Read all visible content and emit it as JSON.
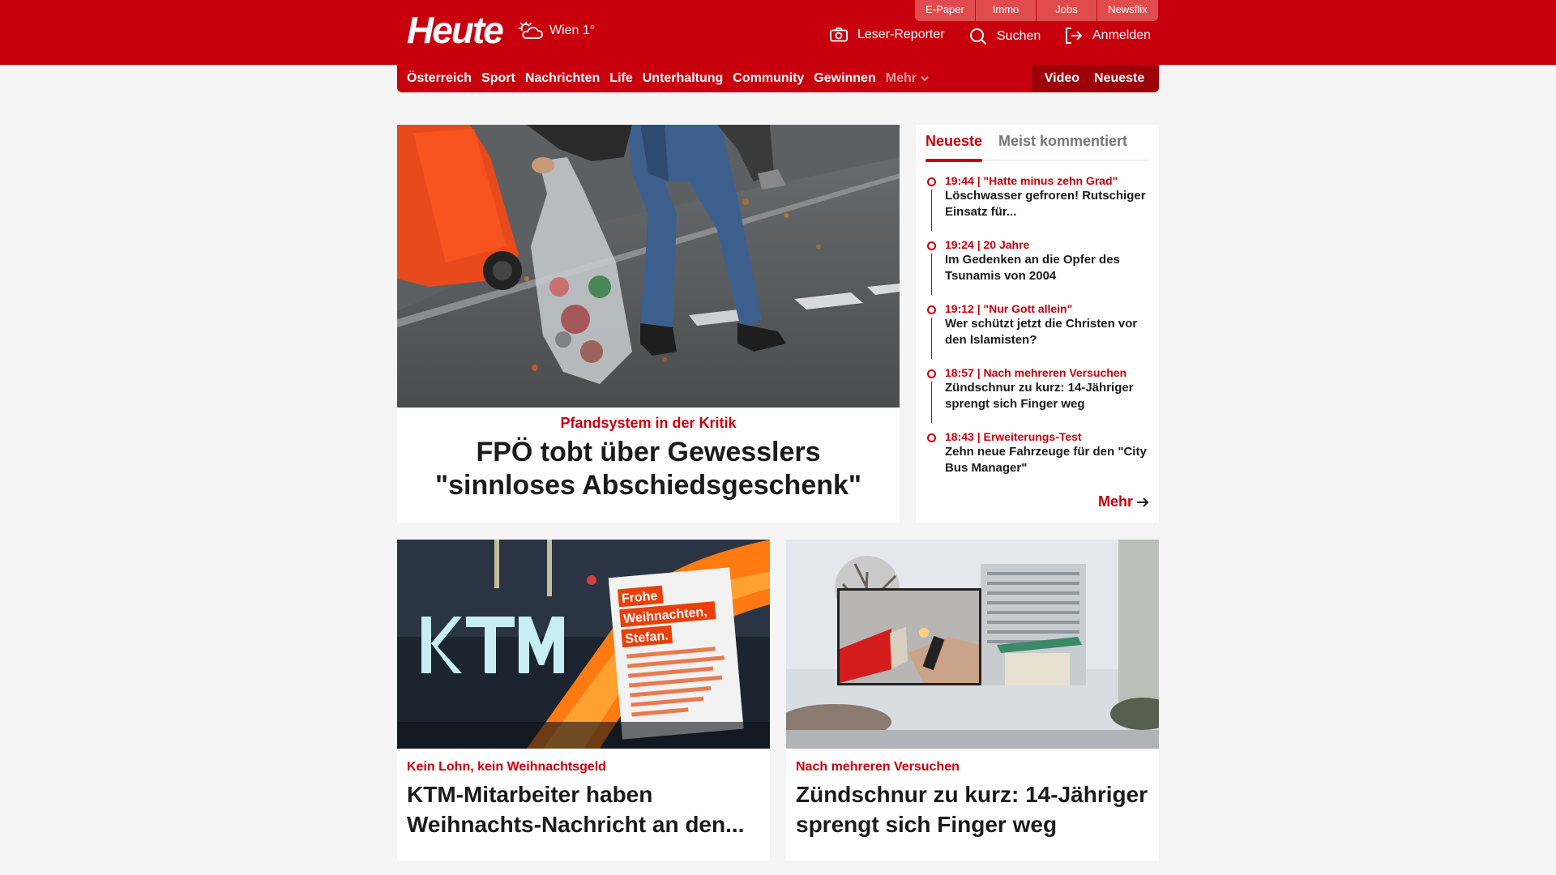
{
  "header": {
    "logo": "Heute",
    "weather": "Wien 1°",
    "top_links": [
      "E-Paper",
      "Immo",
      "Jobs",
      "Newsflix"
    ],
    "actions": {
      "reporter": "Leser-Reporter",
      "search": "Suchen",
      "login": "Anmelden"
    }
  },
  "nav": {
    "items": [
      "Österreich",
      "Sport",
      "Nachrichten",
      "Life",
      "Unterhaltung",
      "Community",
      "Gewinnen"
    ],
    "more": "Mehr",
    "video": "Video",
    "latest": "Neueste"
  },
  "lead": {
    "kicker": "Pfandsystem in der Kritik",
    "title": "FPÖ tobt über Gewesslers \"sinnloses Abschiedsgeschenk\""
  },
  "sidebar": {
    "tabs": [
      "Neueste",
      "Meist kommentiert"
    ],
    "items": [
      {
        "meta": "19:44 | \"Hatte minus zehn Grad\"",
        "title": "Löschwasser gefroren! Rutschiger Einsatz für..."
      },
      {
        "meta": "19:24 | 20 Jahre",
        "title": "Im Gedenken an die Opfer des Tsunamis von 2004"
      },
      {
        "meta": "19:12 | \"Nur Gott allein\"",
        "title": "Wer schützt jetzt die Christen vor den Islamisten?"
      },
      {
        "meta": "18:57 | Nach mehreren Versuchen",
        "title": "Zündschnur zu kurz: 14-Jähriger sprengt sich Finger weg"
      },
      {
        "meta": "18:43 | Erweiterungs-Test",
        "title": "Zehn neue Fahrzeuge für den \"City Bus Manager\""
      }
    ],
    "more": "Mehr"
  },
  "cards": [
    {
      "kicker": "Kein Lohn, kein Weihnachtsgeld",
      "title": "KTM-Mitarbeiter haben Weihnachts-Nachricht an den...",
      "sign_logo": "KTM",
      "sign_lines": [
        "Frohe",
        "Weihnachten,",
        "Stefan."
      ]
    },
    {
      "kicker": "Nach mehreren Versuchen",
      "title": "Zündschnur zu kurz: 14-Jähriger sprengt sich Finger weg"
    }
  ],
  "colors": {
    "brand": "#c8000d",
    "brand_dark": "#9e0009",
    "page_bg": "#f5f5f5"
  }
}
